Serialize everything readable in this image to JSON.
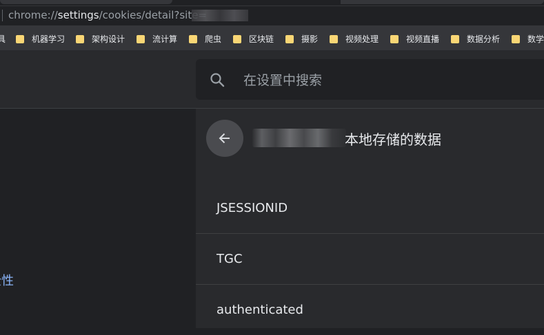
{
  "browser": {
    "url_prefix": "chrome://",
    "url_host": "settings",
    "url_path": "/cookies/detail?site="
  },
  "bookmarks": [
    {
      "label": "具"
    },
    {
      "label": "机器学习"
    },
    {
      "label": "架构设计"
    },
    {
      "label": "流计算"
    },
    {
      "label": "爬虫"
    },
    {
      "label": "区块链"
    },
    {
      "label": "摄影"
    },
    {
      "label": "视频处理"
    },
    {
      "label": "视频直播"
    },
    {
      "label": "数据分析"
    },
    {
      "label": "数学"
    }
  ],
  "search": {
    "placeholder": "在设置中搜索"
  },
  "nav": {
    "partial_item": "全性"
  },
  "detail": {
    "title_suffix": "本地存储的数据",
    "items": [
      {
        "label": "JSESSIONID"
      },
      {
        "label": "TGC"
      },
      {
        "label": "authenticated"
      }
    ]
  },
  "colors": {
    "background": "#202124",
    "panel": "#292a2d",
    "link_blue": "#8ab4f8",
    "folder_yellow": "#f9d675"
  }
}
